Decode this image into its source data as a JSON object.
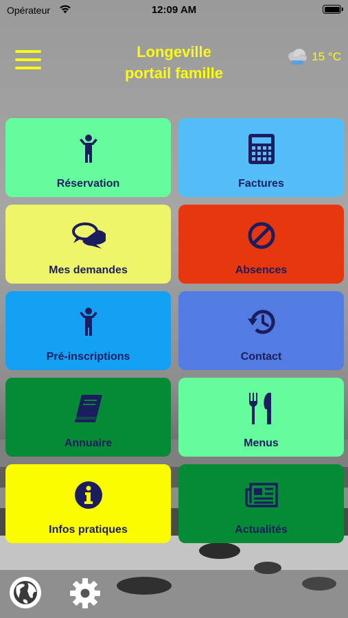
{
  "status_bar": {
    "carrier": "Opérateur",
    "time": "12:09 AM"
  },
  "header": {
    "title_line1": "Longeville",
    "title_line2": "portail famille",
    "temperature": "15 °C",
    "weather_icon": "cloud-rain-icon"
  },
  "colors": {
    "accent": "#fafb14",
    "label": "#1c1d5e"
  },
  "tiles": [
    {
      "label": "Réservation",
      "icon": "child-icon",
      "color": "#65fc9e"
    },
    {
      "label": "Factures",
      "icon": "calculator-icon",
      "color": "#52bdf6"
    },
    {
      "label": "Mes demandes",
      "icon": "chat-bubbles-icon",
      "color": "#eef569"
    },
    {
      "label": "Absences",
      "icon": "forbidden-icon",
      "color": "#e6370f"
    },
    {
      "label": "Pré-inscriptions",
      "icon": "child-icon",
      "color": "#14a1f4"
    },
    {
      "label": "Contact",
      "icon": "history-icon",
      "color": "#527ce1"
    },
    {
      "label": "Annuaire",
      "icon": "book-icon",
      "color": "#058a36"
    },
    {
      "label": "Menus",
      "icon": "utensils-icon",
      "color": "#65fc9e"
    },
    {
      "label": "Infos pratiques",
      "icon": "info-icon",
      "color": "#fcfc00"
    },
    {
      "label": "Actualités",
      "icon": "newspaper-icon",
      "color": "#058a36"
    }
  ],
  "footer": {
    "left_icon": "globe-icon",
    "right_icon": "gear-icon"
  }
}
